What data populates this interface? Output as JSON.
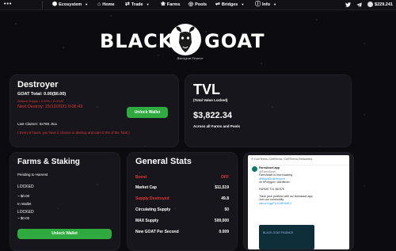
{
  "nav": {
    "more": "•••",
    "items": [
      {
        "icon": "⬢",
        "label": "Ecosystem",
        "dropdown": true
      },
      {
        "icon": "⌂",
        "label": "Home",
        "dropdown": false
      },
      {
        "icon": "⇄",
        "label": "Trade",
        "dropdown": true
      },
      {
        "icon": "❀",
        "label": "Farms",
        "dropdown": false
      },
      {
        "icon": "◎",
        "label": "Pools",
        "dropdown": false
      },
      {
        "icon": "⇌",
        "label": "Bridges",
        "dropdown": true
      },
      {
        "icon": "ⓘ",
        "label": "Info",
        "dropdown": true
      }
    ],
    "price": "$229.241"
  },
  "logo": {
    "word1": "BLACK",
    "word2": "GOAT",
    "tagline": "Blackgoat Finance"
  },
  "destroyer": {
    "title": "Destroyer",
    "goat_total_label": "GOAT Total:",
    "goat_total_value": "0.00($0.00)",
    "reduce_supply": "Reduce Supply = 0.00% = 0 GOAT",
    "next_destroy_label": "Next Destroy:",
    "next_destroy_value": "15/12/2021 0:06:43",
    "unlock_button": "Unlock Wallet",
    "last_claimer_label": "Last Claimer:",
    "last_claimer_value": "0x769..9ca",
    "note": "( Every 8 hours, you have a chance to destroy and earn 0.5% of the Total )"
  },
  "tvl": {
    "title": "TVL",
    "subtitle": "(Total Value Locked)",
    "value": "$3,822.34",
    "caption": "Across all Farms and Pools"
  },
  "farms": {
    "title": "Farms & Staking",
    "pending_label": "Pending to Harvest",
    "locked_1": "LOCKED",
    "value_1": "~ $0.00",
    "in_wallet_label": "In Wallet",
    "locked_2": "LOCKED",
    "value_2": "~ $0.00",
    "unlock_button": "Unlock Wallet"
  },
  "stats": {
    "title": "General Stats",
    "rows": [
      {
        "label": "Boost",
        "value": "OFF",
        "red": true
      },
      {
        "label": "Market Cap",
        "value": "$11,519",
        "red": false
      },
      {
        "label": "Supply Destroyed",
        "value": "49.8",
        "red": true
      },
      {
        "label": "Circulating Supply",
        "value": "50",
        "red": false
      },
      {
        "label": "MAX Supply",
        "value": "500,000",
        "red": false
      },
      {
        "label": "New GOAT Per Second",
        "value": "0.009",
        "red": false
      }
    ]
  },
  "tweet": {
    "header": "CoinTerms / DefiTerms / DeFiTerms Retweeted",
    "name": "FarmAsset.app",
    "handle": "@FarmAsset_",
    "line1": "FarmAsset is now tracking",
    "line2": "@BlackGoatFinance",
    "line3": "on #Polygon / #Arbitrum",
    "tvl_line": "FARMS TVL $8.57K",
    "track_line": "Track your portfolio with us! farmasset.app",
    "join_line": "Join our community",
    "discord": "discord.gg/FU1OdE9MEJ",
    "image_label": "BLACK GOAT FINANCE"
  }
}
